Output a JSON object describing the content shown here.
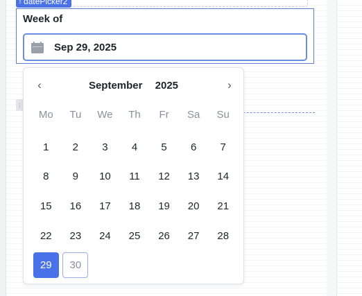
{
  "widget": {
    "name": "datePicker2",
    "label": "Week of",
    "value": "Sep 29, 2025"
  },
  "icons": {
    "calendar": "calendar-icon",
    "prev": "chevron-left-icon",
    "next": "chevron-right-icon",
    "drag": "drag-handle-icon"
  },
  "calendar": {
    "month": "September",
    "year": "2025",
    "prev_symbol": "‹",
    "next_symbol": "›",
    "weekdays": [
      "Mo",
      "Tu",
      "We",
      "Th",
      "Fr",
      "Sa",
      "Su"
    ],
    "weeks": [
      [
        "1",
        "2",
        "3",
        "4",
        "5",
        "6",
        "7"
      ],
      [
        "8",
        "9",
        "10",
        "11",
        "12",
        "13",
        "14"
      ],
      [
        "15",
        "16",
        "17",
        "18",
        "19",
        "20",
        "21"
      ],
      [
        "22",
        "23",
        "24",
        "25",
        "26",
        "27",
        "28"
      ],
      [
        "29",
        "30",
        "",
        "",
        "",
        "",
        ""
      ]
    ],
    "selected_day": "29",
    "today_day": "30"
  },
  "colors": {
    "accent": "#4a72e8",
    "focus_border": "#6b8ce6"
  }
}
